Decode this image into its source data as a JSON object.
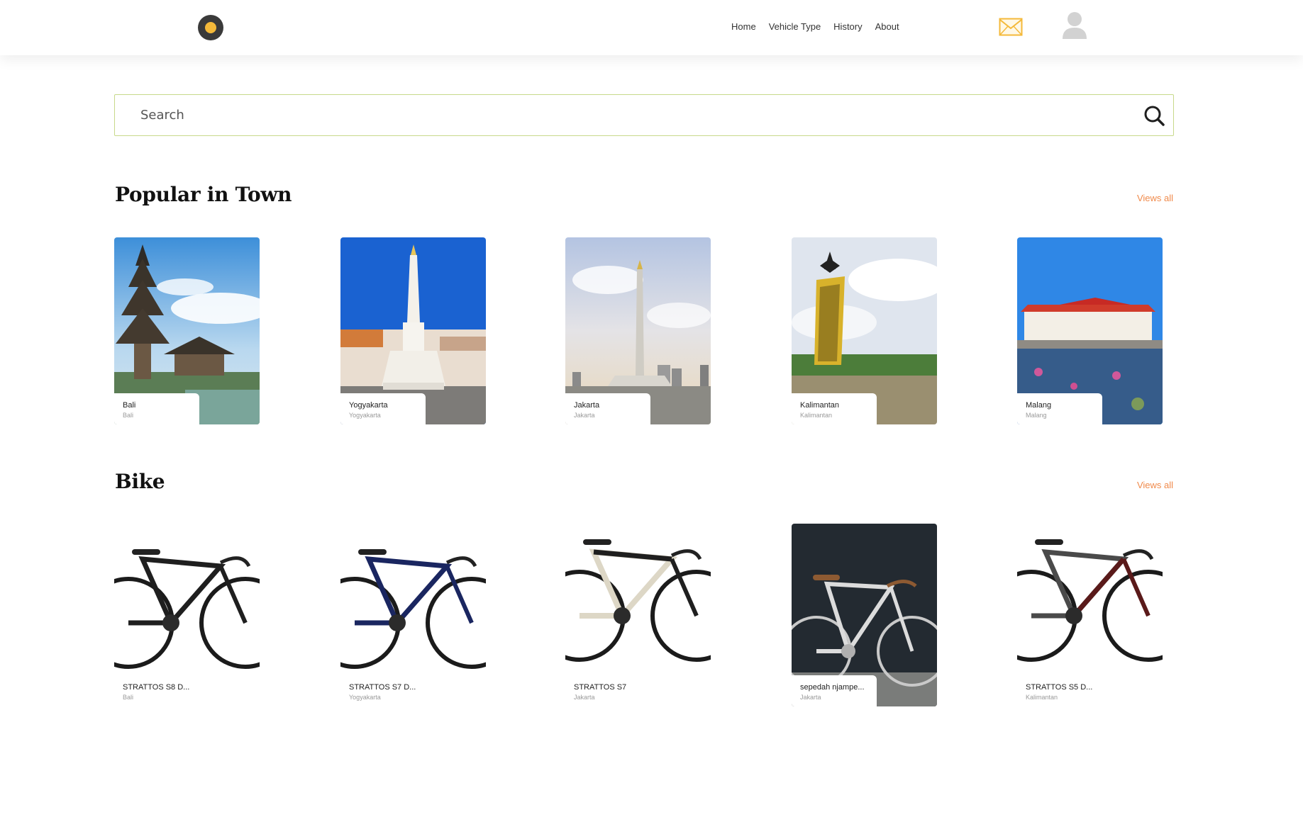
{
  "nav": {
    "items": [
      "Home",
      "Vehicle Type",
      "History",
      "About"
    ]
  },
  "search": {
    "placeholder": "Search"
  },
  "popular": {
    "title": "Popular in Town",
    "views_all": "Views all",
    "items": [
      {
        "name": "Bali",
        "sub": "Bali"
      },
      {
        "name": "Yogyakarta",
        "sub": "Yogyakarta"
      },
      {
        "name": "Jakarta",
        "sub": "Jakarta"
      },
      {
        "name": "Kalimantan",
        "sub": "Kalimantan"
      },
      {
        "name": "Malang",
        "sub": "Malang"
      }
    ]
  },
  "bike": {
    "title": "Bike",
    "views_all": "Views all",
    "items": [
      {
        "name": "STRATTOS S8 D...",
        "sub": "Bali"
      },
      {
        "name": "STRATTOS S7 D...",
        "sub": "Yogyakarta"
      },
      {
        "name": "STRATTOS S7",
        "sub": "Jakarta"
      },
      {
        "name": "sepedah njampe...",
        "sub": "Jakarta"
      },
      {
        "name": "STRATTOS S5 D...",
        "sub": "Kalimantan"
      }
    ]
  },
  "colors": {
    "accent": "#f08a4b",
    "logo": "#f4b93a",
    "mail": "#f4b93a"
  }
}
